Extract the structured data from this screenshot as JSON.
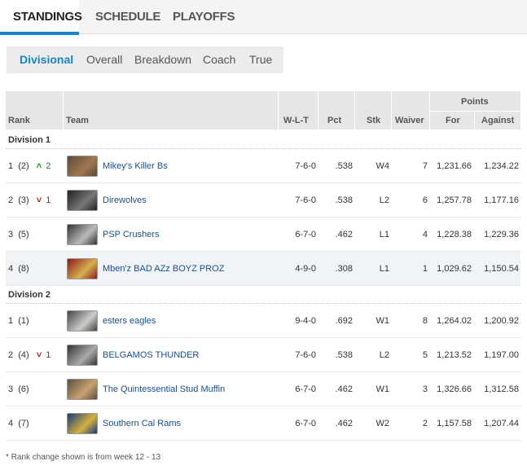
{
  "top_tabs": [
    "STANDINGS",
    "SCHEDULE",
    "PLAYOFFS"
  ],
  "sub_tabs": [
    "Divisional",
    "Overall",
    "Breakdown",
    "Coach",
    "True"
  ],
  "headers": {
    "rank": "Rank",
    "team": "Team",
    "wlt": "W-L-T",
    "pct": "Pct",
    "stk": "Stk",
    "waiver": "Waiver",
    "points": "Points",
    "for": "For",
    "against": "Against"
  },
  "divisions": [
    {
      "label": "Division 1",
      "rows": [
        {
          "rank": "1",
          "prev": "(2)",
          "change_dir": "up",
          "change": "2",
          "team": "Mikey's Killer Bs",
          "wlt": "7-6-0",
          "pct": ".538",
          "stk": "W4",
          "waiver": "7",
          "pf": "1,231.66",
          "pa": "1,234.22"
        },
        {
          "rank": "2",
          "prev": "(3)",
          "change_dir": "down",
          "change": "1",
          "team": "Direwolves",
          "wlt": "7-6-0",
          "pct": ".538",
          "stk": "L2",
          "waiver": "6",
          "pf": "1,257.78",
          "pa": "1,177.16"
        },
        {
          "rank": "3",
          "prev": "(5)",
          "change_dir": "",
          "change": "",
          "team": "PSP Crushers",
          "wlt": "6-7-0",
          "pct": ".462",
          "stk": "L1",
          "waiver": "4",
          "pf": "1,228.38",
          "pa": "1,229.36"
        },
        {
          "rank": "4",
          "prev": "(8)",
          "change_dir": "",
          "change": "",
          "team": "Mben'z BAD AZz BOYZ PROZ",
          "wlt": "4-9-0",
          "pct": ".308",
          "stk": "L1",
          "waiver": "1",
          "pf": "1,029.62",
          "pa": "1,150.54"
        }
      ]
    },
    {
      "label": "Division 2",
      "rows": [
        {
          "rank": "1",
          "prev": "(1)",
          "change_dir": "",
          "change": "",
          "team": "esters eagles",
          "wlt": "9-4-0",
          "pct": ".692",
          "stk": "W1",
          "waiver": "8",
          "pf": "1,264.02",
          "pa": "1,200.92"
        },
        {
          "rank": "2",
          "prev": "(4)",
          "change_dir": "down",
          "change": "1",
          "team": "BELGAMOS THUNDER",
          "wlt": "7-6-0",
          "pct": ".538",
          "stk": "L2",
          "waiver": "5",
          "pf": "1,213.52",
          "pa": "1,197.00"
        },
        {
          "rank": "3",
          "prev": "(6)",
          "change_dir": "",
          "change": "",
          "team": "The Quintessential Stud Muffin",
          "wlt": "6-7-0",
          "pct": ".462",
          "stk": "W1",
          "waiver": "3",
          "pf": "1,326.66",
          "pa": "1,312.58"
        },
        {
          "rank": "4",
          "prev": "(7)",
          "change_dir": "",
          "change": "",
          "team": "Southern Cal Rams",
          "wlt": "6-7-0",
          "pct": ".462",
          "stk": "W2",
          "waiver": "2",
          "pf": "1,157.58",
          "pa": "1,207.44"
        }
      ]
    }
  ],
  "footnote": "* Rank change shown is from week 12 - 13",
  "colors": {
    "accent": "#1b82c8",
    "up": "#1e8a2a",
    "down": "#b52020",
    "link": "#1a4e8b"
  },
  "icons": [
    "chevron-up-icon",
    "chevron-down-icon"
  ]
}
